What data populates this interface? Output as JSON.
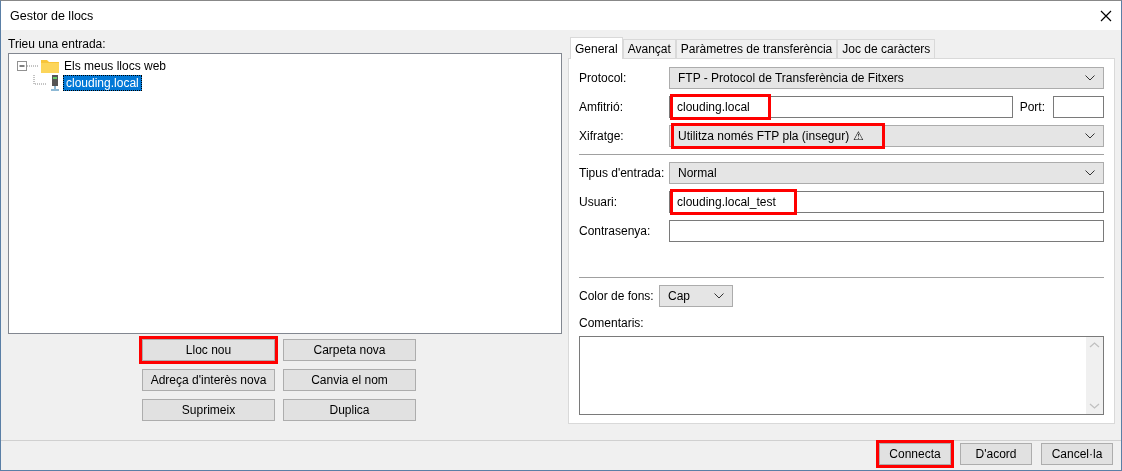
{
  "window": {
    "title": "Gestor de llocs"
  },
  "site_tree": {
    "label": "Trieu una entrada:",
    "items": [
      {
        "label": "Els meus llocs web",
        "kind": "folder",
        "expanded": true,
        "selected": false,
        "children": [
          {
            "label": "clouding.local",
            "kind": "site",
            "selected": true
          }
        ]
      }
    ]
  },
  "site_buttons": [
    {
      "label": "Lloc nou",
      "highlighted": true
    },
    {
      "label": "Carpeta nova",
      "highlighted": false
    },
    {
      "label": "Adreça d'interès nova",
      "highlighted": false
    },
    {
      "label": "Canvia el nom",
      "highlighted": false
    },
    {
      "label": "Suprimeix",
      "highlighted": false
    },
    {
      "label": "Duplica",
      "highlighted": false
    }
  ],
  "tabs": [
    {
      "label": "General",
      "selected": true
    },
    {
      "label": "Avançat",
      "selected": false
    },
    {
      "label": "Paràmetres de transferència",
      "selected": false
    },
    {
      "label": "Joc de caràcters",
      "selected": false
    }
  ],
  "connection_fields": [
    {
      "kind": "select",
      "label": "Protocol:",
      "value": "FTP - Protocol de Transferència de Fitxers",
      "highlighted": false
    },
    {
      "kind": "host",
      "label": "Amfitrió:",
      "value": "clouding.local",
      "highlighted": true,
      "port_label": "Port:"
    },
    {
      "kind": "select",
      "label": "Xifratge:",
      "value": "Utilitza només FTP pla (insegur) ⚠",
      "highlighted": true
    }
  ],
  "login_fields": [
    {
      "kind": "select",
      "label": "Tipus d'entrada:",
      "value": "Normal",
      "highlighted": false
    },
    {
      "kind": "text",
      "label": "Usuari:",
      "value": "clouding.local_test",
      "highlighted": true
    },
    {
      "kind": "password",
      "label": "Contrasenya:",
      "highlighted": false
    }
  ],
  "background_color": {
    "label": "Color de fons:",
    "value": "Cap"
  },
  "comments": {
    "label": "Comentaris:"
  },
  "dialog_buttons": [
    {
      "label": "Connecta",
      "highlighted": true
    },
    {
      "label": "D'acord",
      "highlighted": false
    },
    {
      "label": "Cancel·la",
      "highlighted": false
    }
  ]
}
